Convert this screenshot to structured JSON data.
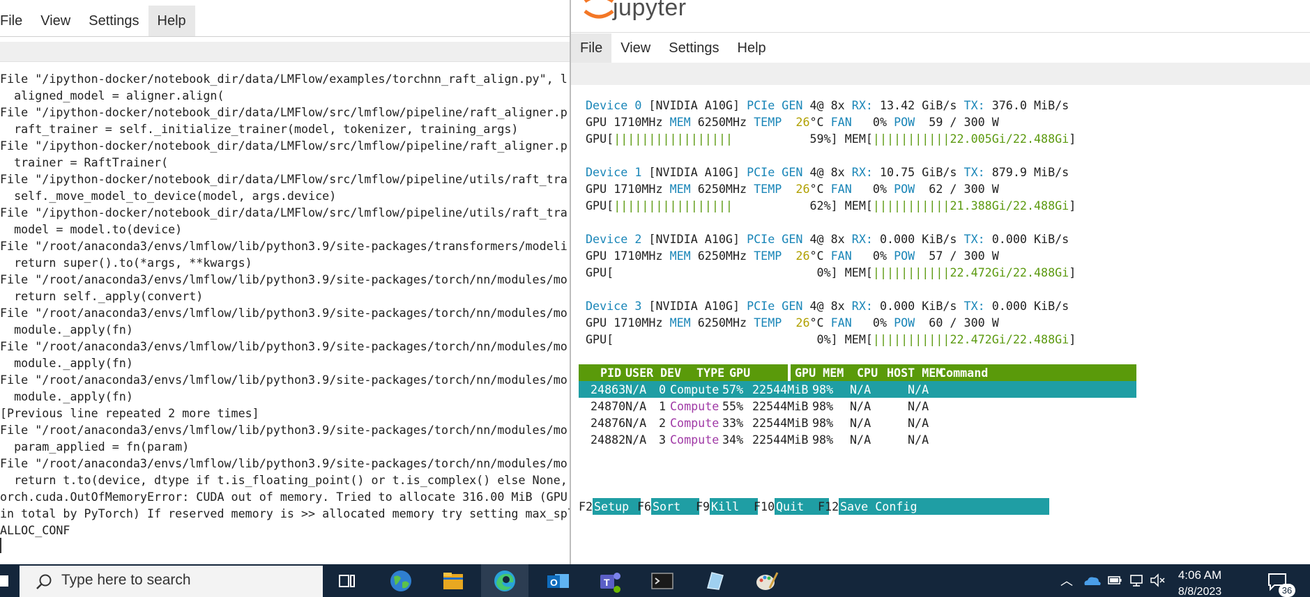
{
  "left_window": {
    "menu": [
      "File",
      "View",
      "Settings",
      "Help"
    ],
    "terminal_lines": [
      "File \"/ipython-docker/notebook_dir/data/LMFlow/examples/torchnn_raft_align.py\", l",
      "  aligned_model = aligner.align(",
      "File \"/ipython-docker/notebook_dir/data/LMFlow/src/lmflow/pipeline/raft_aligner.p",
      "  raft_trainer = self._initialize_trainer(model, tokenizer, training_args)",
      "File \"/ipython-docker/notebook_dir/data/LMFlow/src/lmflow/pipeline/raft_aligner.p",
      "  trainer = RaftTrainer(",
      "File \"/ipython-docker/notebook_dir/data/LMFlow/src/lmflow/pipeline/utils/raft_tra",
      "  self._move_model_to_device(model, args.device)",
      "File \"/ipython-docker/notebook_dir/data/LMFlow/src/lmflow/pipeline/utils/raft_tra",
      "  model = model.to(device)",
      "File \"/root/anaconda3/envs/lmflow/lib/python3.9/site-packages/transformers/modeli",
      "  return super().to(*args, **kwargs)",
      "File \"/root/anaconda3/envs/lmflow/lib/python3.9/site-packages/torch/nn/modules/mo",
      "  return self._apply(convert)",
      "File \"/root/anaconda3/envs/lmflow/lib/python3.9/site-packages/torch/nn/modules/mo",
      "  module._apply(fn)",
      "File \"/root/anaconda3/envs/lmflow/lib/python3.9/site-packages/torch/nn/modules/mo",
      "  module._apply(fn)",
      "File \"/root/anaconda3/envs/lmflow/lib/python3.9/site-packages/torch/nn/modules/mo",
      "  module._apply(fn)",
      "[Previous line repeated 2 more times]",
      "File \"/root/anaconda3/envs/lmflow/lib/python3.9/site-packages/torch/nn/modules/mo",
      "  param_applied = fn(param)",
      "File \"/root/anaconda3/envs/lmflow/lib/python3.9/site-packages/torch/nn/modules/mo",
      "  return t.to(device, dtype if t.is_floating_point() or t.is_complex() else None,",
      "orch.cuda.OutOfMemoryError: CUDA out of memory. Tried to allocate 316.00 MiB (GPU",
      "in total by PyTorch) If reserved memory is >> allocated memory try setting max_spl",
      "ALLOC_CONF"
    ]
  },
  "right_window": {
    "app_title": "jupyter",
    "menu": [
      "File",
      "View",
      "Settings",
      "Help"
    ],
    "devices": [
      {
        "id": "Device 0",
        "model": "[NVIDIA A10G]",
        "pcie": "4@ 8x",
        "rx": "13.42 GiB/s",
        "tx": "376.0 MiB/s",
        "gpu_clock": "1710MHz",
        "mem_clock": "6250MHz",
        "temp": "26",
        "fan": "0%",
        "pow": "59 / 300 W",
        "gpu_util": "59%",
        "gpu_util_value": 59,
        "mem_used": "22.005Gi/22.488Gi",
        "mem_fraction": 0.98
      },
      {
        "id": "Device 1",
        "model": "[NVIDIA A10G]",
        "pcie": "4@ 8x",
        "rx": "10.75 GiB/s",
        "tx": "879.9 MiB/s",
        "gpu_clock": "1710MHz",
        "mem_clock": "6250MHz",
        "temp": "26",
        "fan": "0%",
        "pow": "62 / 300 W",
        "gpu_util": "62%",
        "gpu_util_value": 62,
        "mem_used": "21.388Gi/22.488Gi",
        "mem_fraction": 0.95
      },
      {
        "id": "Device 2",
        "model": "[NVIDIA A10G]",
        "pcie": "4@ 8x",
        "rx": "0.000 KiB/s",
        "tx": "0.000 KiB/s",
        "gpu_clock": "1710MHz",
        "mem_clock": "6250MHz",
        "temp": "26",
        "fan": "0%",
        "pow": "57 / 300 W",
        "gpu_util": "0%",
        "gpu_util_value": 0,
        "mem_used": "22.472Gi/22.488Gi",
        "mem_fraction": 0.999
      },
      {
        "id": "Device 3",
        "model": "[NVIDIA A10G]",
        "pcie": "4@ 8x",
        "rx": "0.000 KiB/s",
        "tx": "0.000 KiB/s",
        "gpu_clock": "1710MHz",
        "mem_clock": "6250MHz",
        "temp": "26",
        "fan": "0%",
        "pow": "60 / 300 W",
        "gpu_util": "0%",
        "gpu_util_value": 0,
        "mem_used": "22.472Gi/22.488Gi",
        "mem_fraction": 0.999
      }
    ],
    "labels": {
      "pcie": "PCIe GEN",
      "rx": "RX:",
      "tx": "TX:",
      "gpu": "GPU",
      "mem": "MEM",
      "temp": "TEMP",
      "deg": "°C",
      "fan": "FAN",
      "pow": "POW",
      "gpu_bar": "GPU[",
      "mem_bar": "MEM["
    },
    "process_table": {
      "columns": [
        "PID",
        "USER",
        "DEV",
        "TYPE",
        "GPU",
        "GPU MEM",
        "CPU",
        "HOST MEM",
        "Command"
      ],
      "rows": [
        {
          "pid": "24863",
          "user": "N/A",
          "dev": "0",
          "type": "Compute",
          "gpu": "57%",
          "gpu_mem": "22544MiB",
          "mem_pct": "98%",
          "cpu": "N/A",
          "host_mem": "N/A",
          "selected": true
        },
        {
          "pid": "24870",
          "user": "N/A",
          "dev": "1",
          "type": "Compute",
          "gpu": "55%",
          "gpu_mem": "22544MiB",
          "mem_pct": "98%",
          "cpu": "N/A",
          "host_mem": "N/A",
          "selected": false
        },
        {
          "pid": "24876",
          "user": "N/A",
          "dev": "2",
          "type": "Compute",
          "gpu": "33%",
          "gpu_mem": "22544MiB",
          "mem_pct": "98%",
          "cpu": "N/A",
          "host_mem": "N/A",
          "selected": false
        },
        {
          "pid": "24882",
          "user": "N/A",
          "dev": "3",
          "type": "Compute",
          "gpu": "34%",
          "gpu_mem": "22544MiB",
          "mem_pct": "98%",
          "cpu": "N/A",
          "host_mem": "N/A",
          "selected": false
        }
      ]
    },
    "function_keys": [
      {
        "key": "F2",
        "label": "Setup"
      },
      {
        "key": "F6",
        "label": "Sort"
      },
      {
        "key": "F9",
        "label": "Kill"
      },
      {
        "key": "F10",
        "label": "Quit"
      },
      {
        "key": "F12",
        "label": "Save Config"
      }
    ]
  },
  "taskbar": {
    "search_placeholder": "Type here to search",
    "clock_time": "4:06 AM",
    "clock_date": "8/8/2023",
    "notification_count": "36",
    "pinned_icons": [
      "task-view-icon",
      "globe-app-icon",
      "file-explorer-icon",
      "edge-browser-icon",
      "outlook-icon",
      "teams-icon",
      "terminal-icon",
      "notepad-icon",
      "paint-icon"
    ]
  },
  "colors": {
    "cyan": "#1a86b8",
    "green": "#5c9a10",
    "yellow": "#b0a000",
    "magenta": "#a03aa6",
    "header_bar": "#5a9a0a",
    "selected_row": "#1f9ea4",
    "taskbar": "#14263b"
  }
}
